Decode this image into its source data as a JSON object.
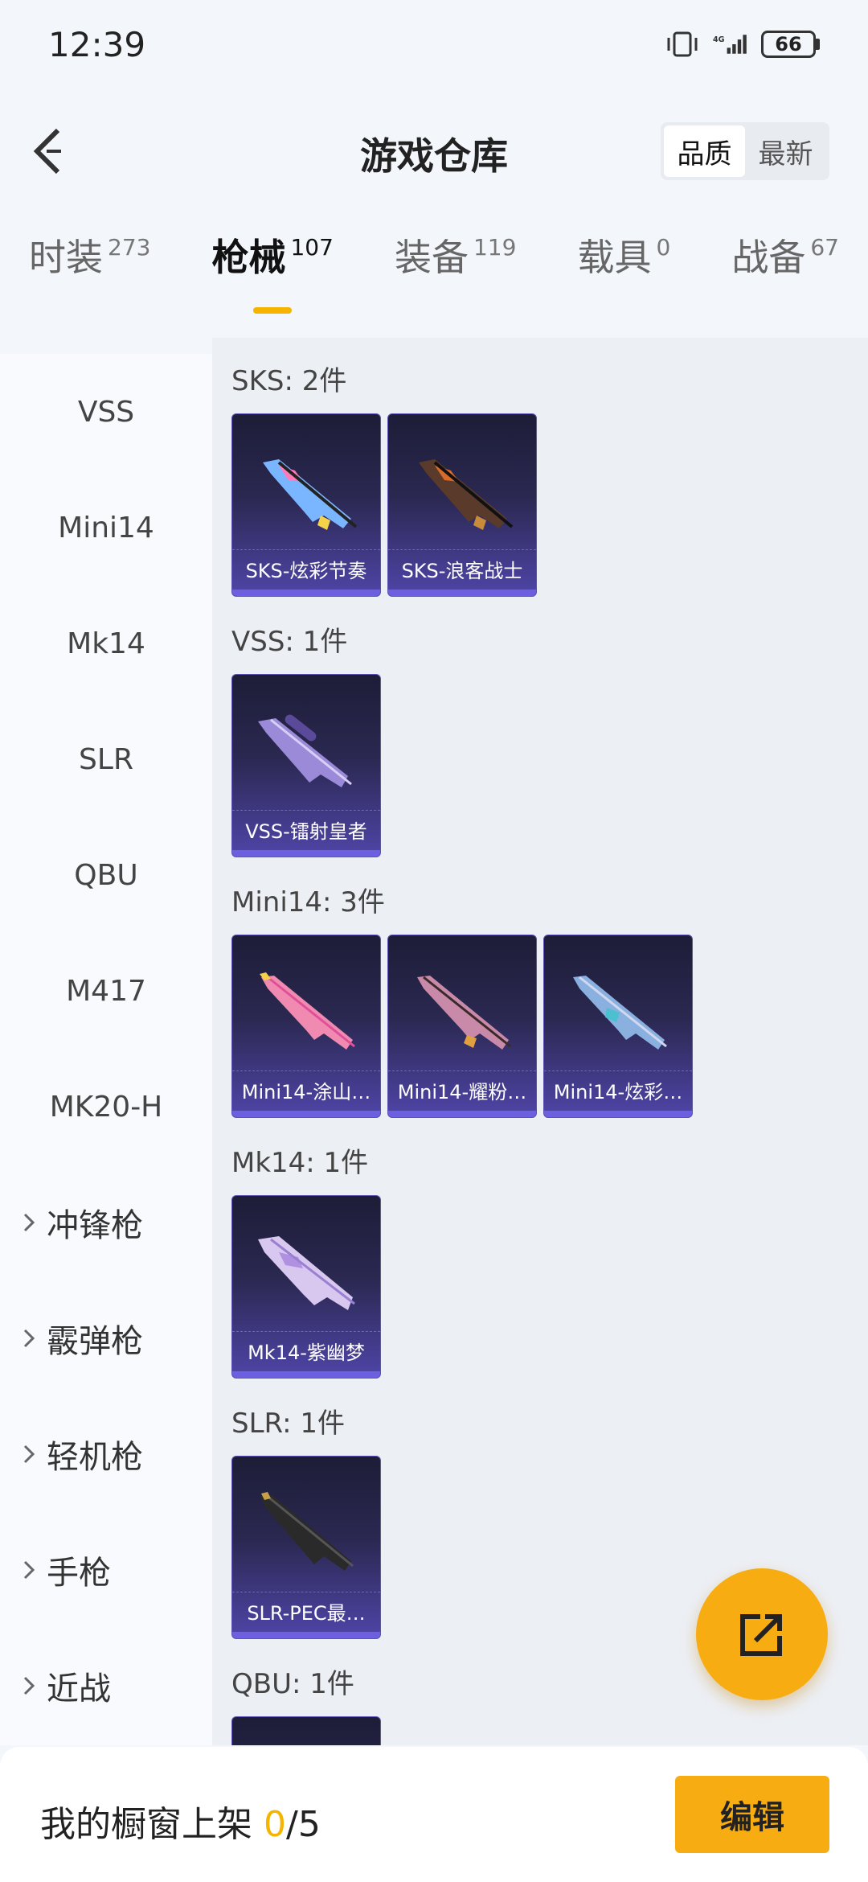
{
  "status_bar": {
    "time": "12:39",
    "network": "4G",
    "battery": "66"
  },
  "header": {
    "title": "游戏仓库",
    "sort": {
      "quality": "品质",
      "newest": "最新"
    }
  },
  "tabs": [
    {
      "label": "时装",
      "count": "273"
    },
    {
      "label": "枪械",
      "count": "107"
    },
    {
      "label": "装备",
      "count": "119"
    },
    {
      "label": "载具",
      "count": "0"
    },
    {
      "label": "战备",
      "count": "67"
    }
  ],
  "sidebar": {
    "items": [
      "VSS",
      "Mini14",
      "Mk14",
      "SLR",
      "QBU",
      "M417",
      "MK20-H"
    ],
    "groups": [
      "冲锋枪",
      "霰弹枪",
      "轻机枪",
      "手枪",
      "近战"
    ]
  },
  "sections": [
    {
      "title": "SKS: 2件",
      "items": [
        "SKS-炫彩节奏",
        "SKS-浪客战士"
      ]
    },
    {
      "title": "VSS: 1件",
      "items": [
        "VSS-镭射皇者"
      ]
    },
    {
      "title": "Mini14: 3件",
      "items": [
        "Mini14-涂山…",
        "Mini14-耀粉…",
        "Mini14-炫彩…"
      ]
    },
    {
      "title": "Mk14: 1件",
      "items": [
        "Mk14-紫幽梦"
      ]
    },
    {
      "title": "SLR: 1件",
      "items": [
        "SLR-PEC最…"
      ]
    },
    {
      "title": "QBU: 1件",
      "items": []
    }
  ],
  "bottom": {
    "showcase_label": "我的橱窗上架",
    "current": "0",
    "total": "/5",
    "edit": "编辑"
  },
  "colors": {
    "accent": "#f5b400",
    "card_dark": "#1d1d38",
    "card_purple": "#4f45a8"
  }
}
